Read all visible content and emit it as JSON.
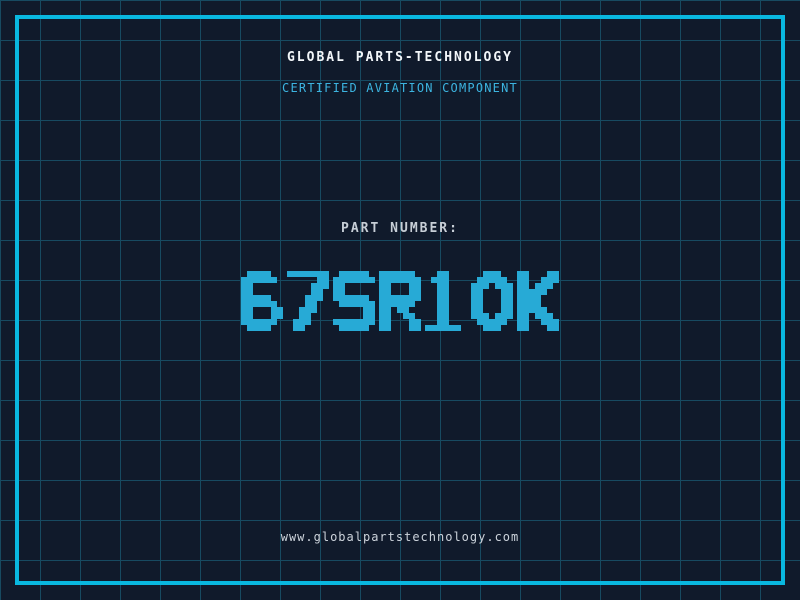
{
  "header": {
    "company": "GLOBAL PARTS-TECHNOLOGY",
    "subtitle": "CERTIFIED AVIATION COMPONENT"
  },
  "part_number": {
    "label": "PART NUMBER:",
    "value": "67SR10K"
  },
  "footer": {
    "website": "www.globalpartstechnology.com"
  },
  "theme": {
    "background": "#101a2b",
    "grid_line": "#174a61",
    "frame_border": "#09b8e0",
    "part_number_cyan": "#27aad6",
    "subtitle_cyan": "#3cb4e0",
    "title_white": "#f2f6f9",
    "label_gray": "#c7ced6"
  }
}
